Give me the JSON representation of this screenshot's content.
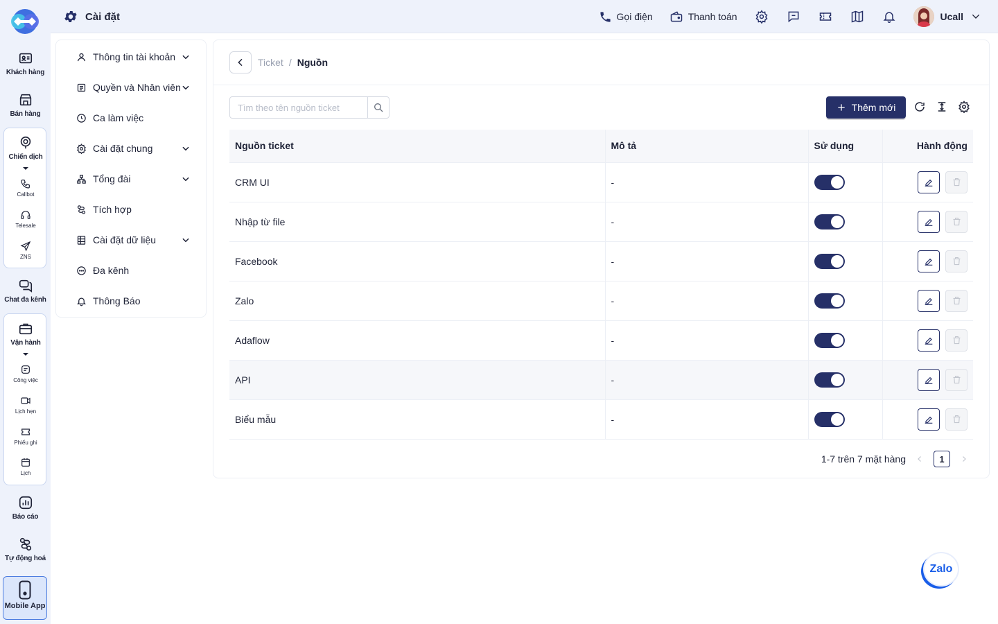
{
  "rail": {
    "items": [
      {
        "label": "Khách hàng",
        "icon": "contact-card-icon"
      },
      {
        "label": "Bán hàng",
        "icon": "store-icon"
      },
      {
        "label": "Chiến dịch",
        "icon": "target-icon"
      },
      {
        "label": "Chat đa kênh",
        "icon": "chat-icon"
      },
      {
        "label": "Vận hành",
        "icon": "briefcase-icon"
      },
      {
        "label": "Báo cáo",
        "icon": "chart-icon"
      },
      {
        "label": "Tự động hoá",
        "icon": "flow-icon"
      }
    ],
    "campaign_sub": [
      {
        "label": "Callbot",
        "icon": "phone-icon"
      },
      {
        "label": "Telesale",
        "icon": "headset-icon"
      },
      {
        "label": "ZNS",
        "icon": "send-icon"
      }
    ],
    "ops_sub": [
      {
        "label": "Công việc",
        "icon": "task-icon"
      },
      {
        "label": "Lịch hẹn",
        "icon": "calendar-video-icon"
      },
      {
        "label": "Phiếu ghi",
        "icon": "ticket-icon"
      },
      {
        "label": "Lịch",
        "icon": "calendar-icon"
      }
    ],
    "mobile_app": "Mobile App"
  },
  "topbar": {
    "title": "Cài đặt",
    "call": "Gọi điện",
    "payment": "Thanh toán",
    "user": "Ucall"
  },
  "menu": {
    "items": [
      {
        "label": "Thông tin tài khoản",
        "expandable": true
      },
      {
        "label": "Quyền và Nhân viên",
        "expandable": true
      },
      {
        "label": "Ca làm việc",
        "expandable": false
      },
      {
        "label": "Cài đặt chung",
        "expandable": true
      },
      {
        "label": "Tổng đài",
        "expandable": true
      },
      {
        "label": "Tích hợp",
        "expandable": false
      },
      {
        "label": "Cài đặt dữ liệu",
        "expandable": true
      },
      {
        "label": "Đa kênh",
        "expandable": false
      },
      {
        "label": "Thông Báo",
        "expandable": false
      }
    ]
  },
  "breadcrumb": {
    "parent": "Ticket",
    "separator": "/",
    "current": "Nguồn"
  },
  "search": {
    "placeholder": "Tìm theo tên nguồn ticket",
    "value": ""
  },
  "toolbar": {
    "add_label": "Thêm mới"
  },
  "table": {
    "headers": {
      "source": "Nguồn ticket",
      "description": "Mô tả",
      "in_use": "Sử dụng",
      "actions": "Hành động"
    },
    "rows": [
      {
        "source": "CRM UI",
        "description": "-",
        "in_use": true
      },
      {
        "source": "Nhập từ file",
        "description": "-",
        "in_use": true
      },
      {
        "source": "Facebook",
        "description": "-",
        "in_use": true
      },
      {
        "source": "Zalo",
        "description": "-",
        "in_use": true
      },
      {
        "source": "Adaflow",
        "description": "-",
        "in_use": true
      },
      {
        "source": "API",
        "description": "-",
        "in_use": true
      },
      {
        "source": "Biểu mẫu",
        "description": "-",
        "in_use": true
      }
    ]
  },
  "pagination": {
    "summary": "1-7 trên 7 mặt hàng",
    "current_page": "1"
  },
  "zalo_widget": "Zalo",
  "colors": {
    "primary": "#263068",
    "background": "#eef2fb",
    "zalo": "#1a5ee8"
  }
}
